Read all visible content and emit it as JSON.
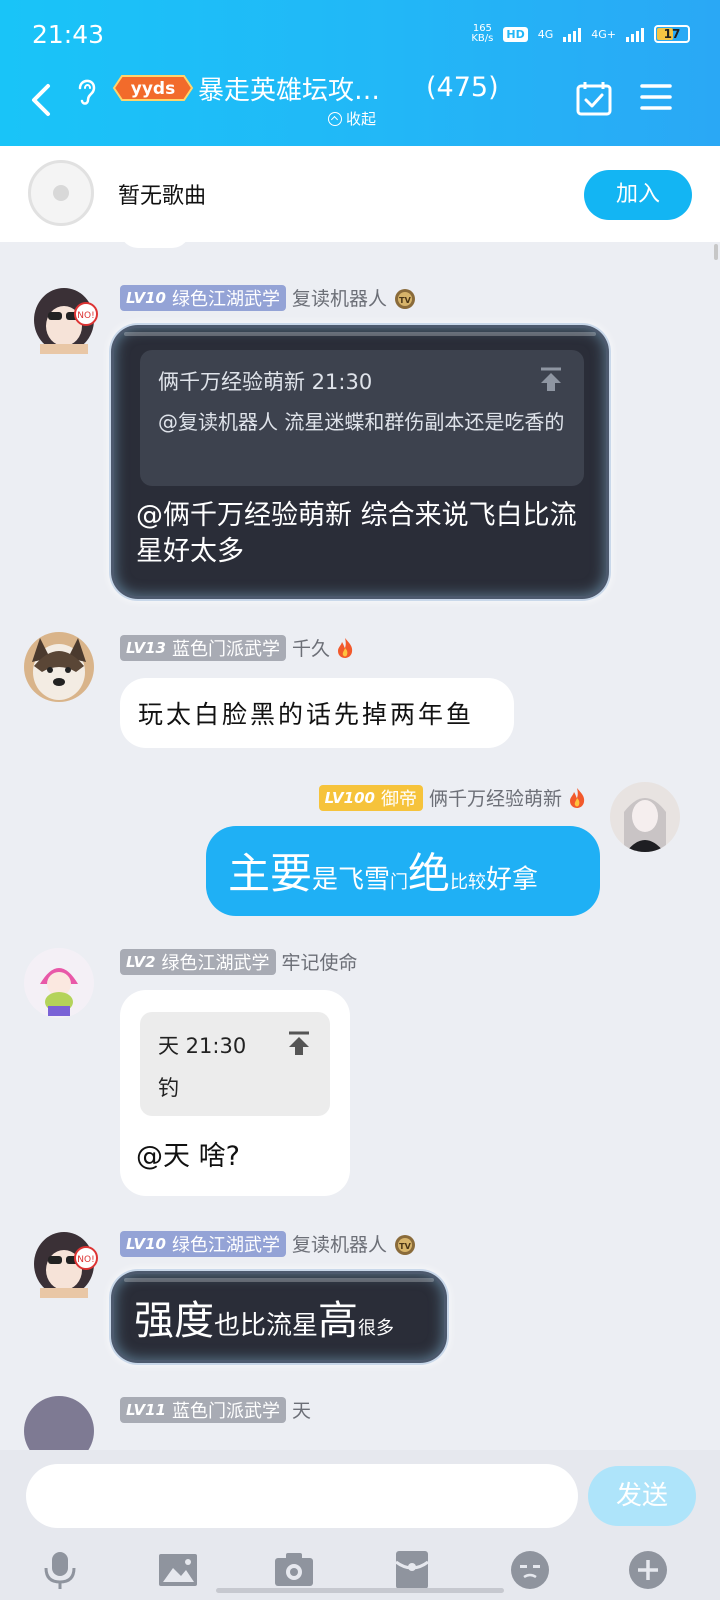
{
  "status": {
    "time": "21:43",
    "net_speed": "165",
    "net_unit": "KB/s",
    "hd": "HD",
    "sim_a": "4G",
    "sim_b": "4G+",
    "battery": "17"
  },
  "header": {
    "badge_text": "yyds",
    "title": "暴走英雄坛攻…",
    "member_count": "(475)",
    "collapse_label": "收起"
  },
  "music": {
    "text": "暂无歌曲",
    "join_label": "加入"
  },
  "messages": [
    {
      "level": "LV10",
      "group": "绿色江湖武学",
      "name": "复读机器人",
      "quote_header": "俩千万经验萌新 21:30",
      "quote_text": "@复读机器人 流星迷蝶和群伤副本还是吃香的",
      "reply": "@俩千万经验萌新 综合来说飞白比流星好太多"
    },
    {
      "level": "LV13",
      "group": "蓝色门派武学",
      "name": "千久",
      "text": "玩太白脸黑的话先掉两年鱼"
    },
    {
      "level": "LV100",
      "group": "御帝",
      "name": "俩千万经验萌新",
      "parts": [
        "主要",
        "是飞雪",
        "门",
        "绝",
        "比较",
        "好拿"
      ]
    },
    {
      "level": "LV2",
      "group": "绿色江湖武学",
      "name": "牢记使命",
      "quote_header": "天 21:30",
      "quote_text": "钓",
      "reply": "@天 啥?"
    },
    {
      "level": "LV10",
      "group": "绿色江湖武学",
      "name": "复读机器人",
      "parts": [
        "强度",
        "也比流星",
        "高",
        "很多"
      ]
    },
    {
      "level": "LV11",
      "group": "蓝色门派武学",
      "name": "天"
    }
  ],
  "input": {
    "placeholder": "",
    "send_label": "发送"
  },
  "toolbar": [
    "microphone-icon",
    "image-icon",
    "camera-icon",
    "red-packet-icon",
    "emoji-icon",
    "plus-icon"
  ],
  "colors": {
    "brand": "#1fb0f5",
    "send_disabled": "#aee4fa",
    "badge_gold": "#f6c33b",
    "badge_blue": "#94a3d6"
  }
}
